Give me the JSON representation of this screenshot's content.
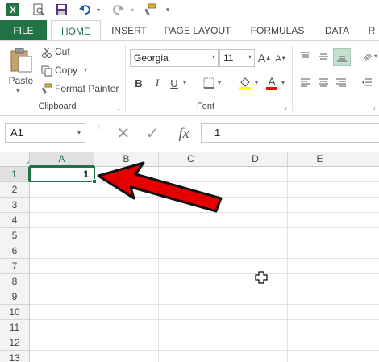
{
  "quick_access": {
    "icons": [
      "excel-logo-icon",
      "print-preview-icon",
      "save-icon",
      "undo-icon",
      "redo-icon",
      "format-painter-icon",
      "customize-qat-icon"
    ]
  },
  "tabs": [
    "FILE",
    "HOME",
    "INSERT",
    "PAGE LAYOUT",
    "FORMULAS",
    "DATA",
    "R"
  ],
  "clipboard": {
    "paste": "Paste",
    "cut": "Cut",
    "copy": "Copy",
    "format_painter": "Format Painter",
    "label": "Clipboard"
  },
  "font": {
    "family": "Georgia",
    "size": "11",
    "grow": "A",
    "shrink": "A",
    "bold": "B",
    "italic": "I",
    "underline": "U",
    "font_color_letter": "A",
    "label": "Font",
    "highlight_color": "#ffff00",
    "font_color": "#e51400"
  },
  "formula_bar": {
    "name_box": "A1",
    "cancel": "✕",
    "enter": "✓",
    "fx": "fx",
    "content": "1"
  },
  "sheet": {
    "columns": [
      "A",
      "B",
      "C",
      "D",
      "E"
    ],
    "rows": [
      "1",
      "2",
      "3",
      "4",
      "5",
      "6",
      "7",
      "8",
      "9",
      "10",
      "11",
      "12",
      "13"
    ],
    "active_cell": "A1",
    "a1_value": "1"
  },
  "colors": {
    "excel_green": "#217346",
    "arrow_red": "#e50000"
  }
}
